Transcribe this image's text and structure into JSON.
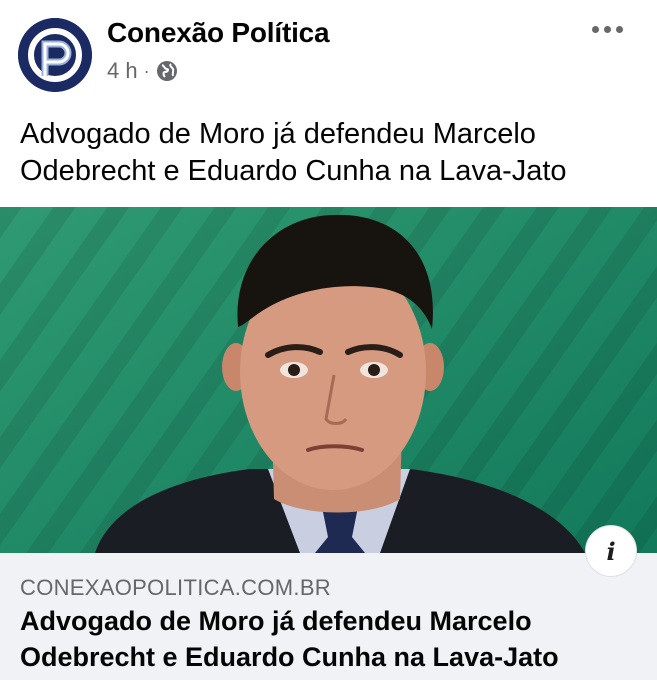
{
  "post": {
    "page_name": "Conexão Política",
    "timestamp": "4 h",
    "separator": "·",
    "text": "Advogado de Moro já defendeu Marcelo Odebrecht e Eduardo Cunha na Lava-Jato",
    "privacy_icon": "globe-icon",
    "menu_icon": "more-options-icon"
  },
  "link_preview": {
    "domain": "CONEXAOPOLITICA.COM.BR",
    "title": "Advogado de Moro já defendeu Marcelo Odebrecht e Eduardo Cunha na Lava-Jato",
    "info_icon": "info-icon",
    "info_glyph": "i"
  },
  "colors": {
    "brand_navy": "#1c2a63",
    "photo_green": "#1f8a63",
    "secondary_text": "#65676b",
    "link_bg": "#f0f2f5"
  }
}
